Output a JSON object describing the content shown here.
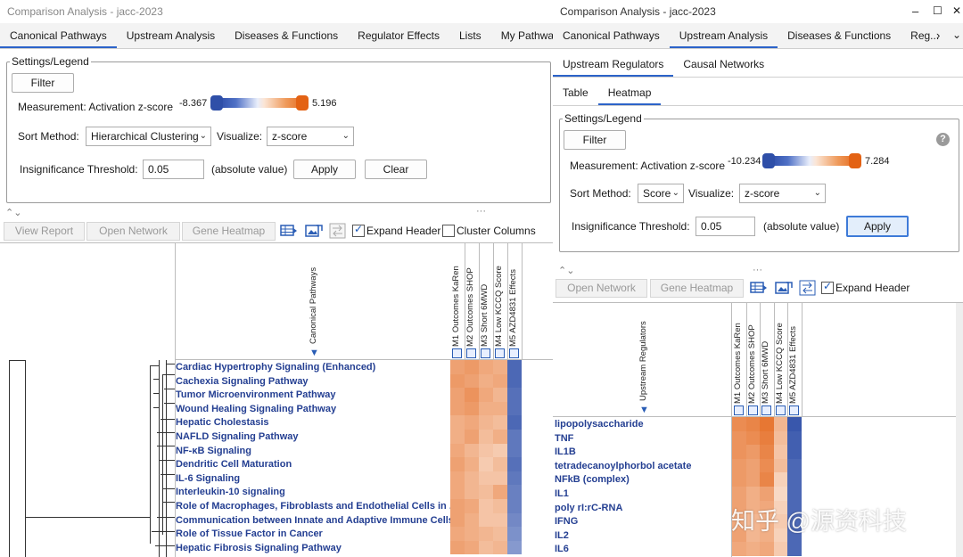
{
  "left": {
    "title": "Comparison Analysis - jacc-2023",
    "tabs": [
      "Canonical Pathways",
      "Upstream Analysis",
      "Diseases & Functions",
      "Regulator Effects",
      "Lists",
      "My Pathways"
    ],
    "settings": {
      "legend": "Settings/Legend",
      "filter": "Filter",
      "measurement_label": "Measurement: Activation z-score",
      "min": "-8.367",
      "max": "5.196",
      "sort_label": "Sort Method:",
      "sort_value": "Hierarchical Clustering",
      "visualize_label": "Visualize:",
      "visualize_value": "z-score",
      "threshold_label": "Insignificance Threshold:",
      "threshold_value": "0.05",
      "absolute": "(absolute value)",
      "apply": "Apply",
      "clear": "Clear"
    },
    "toolbar": {
      "view_report": "View Report",
      "open_network": "Open Network",
      "gene_heatmap": "Gene Heatmap",
      "expand_header": "Expand Header",
      "cluster_columns": "Cluster Columns"
    },
    "heatmap": {
      "row_header": "Canonical Pathways",
      "columns": [
        "M1 Outcomes KaRen",
        "M2 Outcomes SHOP",
        "M3 Short 6MWD",
        "M4 Low KCCQ Score",
        "M5 AZD4831 Effects"
      ],
      "rows": [
        "Cardiac Hypertrophy Signaling (Enhanced)",
        "Cachexia Signaling Pathway",
        "Tumor Microenvironment Pathway",
        "Wound Healing Signaling Pathway",
        "Hepatic Cholestasis",
        "NAFLD Signaling Pathway",
        "NF-κB Signaling",
        "Dendritic Cell Maturation",
        "IL-6 Signaling",
        "Interleukin-10 signaling",
        "Role of Macrophages, Fibroblasts and Endothelial Cells in ...",
        "Communication between Innate and Adaptive Immune Cells",
        "Role of Tissue Factor in Cancer",
        "Hepatic Fibrosis Signaling Pathway"
      ],
      "values": [
        [
          0.55,
          0.6,
          0.5,
          0.45,
          -0.85
        ],
        [
          0.6,
          0.55,
          0.45,
          0.5,
          -0.85
        ],
        [
          0.55,
          0.65,
          0.5,
          0.4,
          -0.8
        ],
        [
          0.55,
          0.6,
          0.45,
          0.45,
          -0.8
        ],
        [
          0.45,
          0.5,
          0.4,
          0.35,
          -0.85
        ],
        [
          0.45,
          0.55,
          0.35,
          0.45,
          -0.75
        ],
        [
          0.5,
          0.4,
          0.3,
          0.25,
          -0.75
        ],
        [
          0.55,
          0.45,
          0.25,
          0.35,
          -0.8
        ],
        [
          0.5,
          0.4,
          0.3,
          0.3,
          -0.75
        ],
        [
          0.5,
          0.4,
          0.35,
          0.5,
          -0.7
        ],
        [
          0.55,
          0.5,
          0.3,
          0.35,
          -0.7
        ],
        [
          0.55,
          0.45,
          0.3,
          0.3,
          -0.65
        ],
        [
          0.5,
          0.45,
          0.4,
          0.35,
          -0.6
        ],
        [
          0.55,
          0.5,
          0.35,
          0.4,
          -0.55
        ]
      ]
    }
  },
  "right": {
    "title": "Comparison Analysis - jacc-2023",
    "window_controls": {
      "minimize": "–",
      "maximize": "☐",
      "close": "✕"
    },
    "tabs": [
      "Canonical Pathways",
      "Upstream Analysis",
      "Diseases & Functions",
      "Reg..."
    ],
    "subtabs": [
      "Upstream Regulators",
      "Causal Networks"
    ],
    "subtabs2": [
      "Table",
      "Heatmap"
    ],
    "settings": {
      "legend": "Settings/Legend",
      "filter": "Filter",
      "measurement_label": "Measurement: Activation z-score",
      "min": "-10.234",
      "max": "7.284",
      "sort_label": "Sort Method:",
      "sort_value": "Score",
      "visualize_label": "Visualize:",
      "visualize_value": "z-score",
      "threshold_label": "Insignificance Threshold:",
      "threshold_value": "0.05",
      "absolute": "(absolute value)",
      "apply": "Apply"
    },
    "toolbar": {
      "open_network": "Open Network",
      "gene_heatmap": "Gene Heatmap",
      "expand_header": "Expand Header"
    },
    "heatmap": {
      "row_header": "Upstream Regulators",
      "columns": [
        "M1 Outcomes KaRen",
        "M2 Outcomes SHOP",
        "M3 Short 6MWD",
        "M4 Low KCCQ Score",
        "M5 AZD4831 Effects"
      ],
      "rows": [
        "lipopolysaccharide",
        "TNF",
        "IL1B",
        "tetradecanoylphorbol acetate",
        "NFkB (complex)",
        "IL1",
        "poly rI:rC-RNA",
        "IFNG",
        "IL2",
        "IL6"
      ],
      "values": [
        [
          0.7,
          0.75,
          0.85,
          0.4,
          -0.95
        ],
        [
          0.65,
          0.7,
          0.8,
          0.35,
          -0.9
        ],
        [
          0.65,
          0.6,
          0.75,
          0.3,
          -0.9
        ],
        [
          0.6,
          0.55,
          0.7,
          0.35,
          -0.85
        ],
        [
          0.6,
          0.55,
          0.75,
          0.2,
          -0.85
        ],
        [
          0.55,
          0.45,
          0.55,
          0.15,
          -0.85
        ],
        [
          0.55,
          0.45,
          0.5,
          0.2,
          -0.85
        ],
        [
          0.5,
          0.4,
          0.45,
          0.25,
          -0.85
        ],
        [
          0.55,
          0.4,
          0.45,
          0.2,
          -0.85
        ],
        [
          0.5,
          0.45,
          0.5,
          0.25,
          -0.85
        ]
      ]
    }
  },
  "watermark": "知乎 @源资科技",
  "colors": {
    "accent": "#2c63c9",
    "link": "#243f92",
    "negative": "#2f4fa8",
    "positive": "#e36214"
  }
}
